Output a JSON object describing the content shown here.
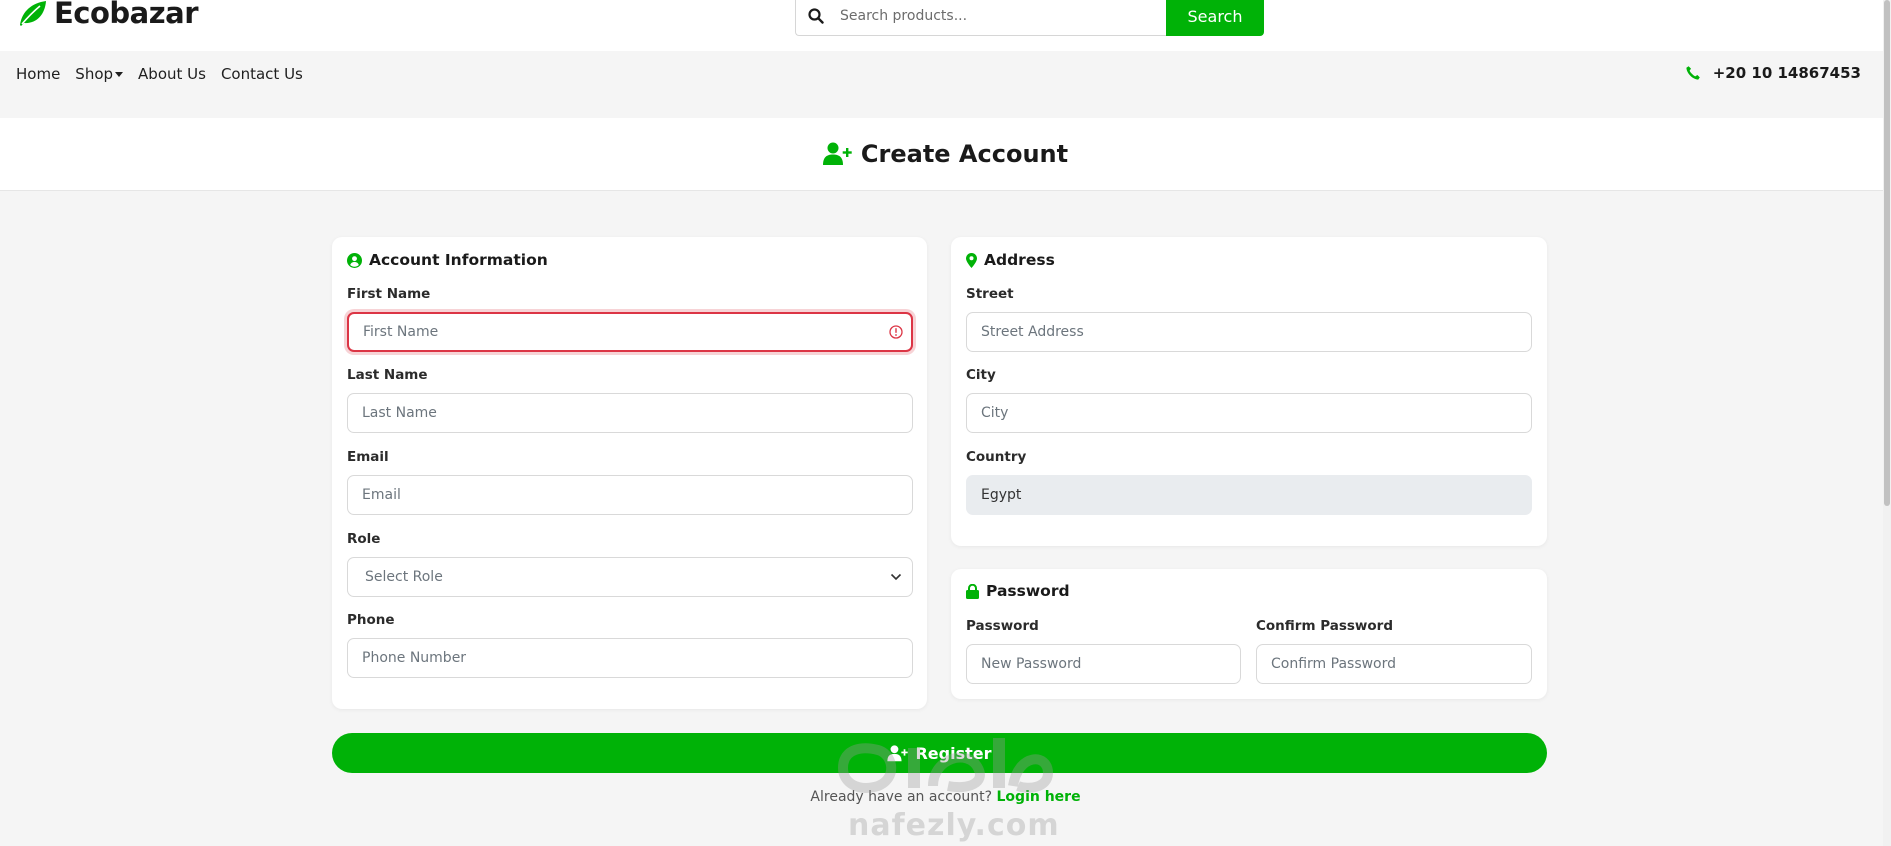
{
  "brand": {
    "name": "Ecobazar"
  },
  "search": {
    "placeholder": "Search products...",
    "button_label": "Search"
  },
  "nav": {
    "home": "Home",
    "shop": "Shop",
    "about": "About Us",
    "contact": "Contact Us"
  },
  "phone": "+20 10 14867453",
  "page": {
    "title": "Create Account"
  },
  "account": {
    "title": "Account Information",
    "first_name": {
      "label": "First Name",
      "placeholder": "First Name"
    },
    "last_name": {
      "label": "Last Name",
      "placeholder": "Last Name"
    },
    "email": {
      "label": "Email",
      "placeholder": "Email"
    },
    "role": {
      "label": "Role",
      "selected": "Select Role"
    },
    "phone": {
      "label": "Phone",
      "placeholder": "Phone Number"
    }
  },
  "address": {
    "title": "Address",
    "street": {
      "label": "Street",
      "placeholder": "Street Address"
    },
    "city": {
      "label": "City",
      "placeholder": "City"
    },
    "country": {
      "label": "Country",
      "value": "Egypt"
    }
  },
  "password": {
    "title": "Password",
    "password": {
      "label": "Password",
      "placeholder": "New Password"
    },
    "confirm": {
      "label": "Confirm Password",
      "placeholder": "Confirm Password"
    }
  },
  "register": {
    "label": "Register"
  },
  "login": {
    "prompt": "Already have an account?",
    "link": "Login here"
  },
  "watermark": {
    "text": "nafezly.com"
  },
  "colors": {
    "accent": "#00b207",
    "error": "#dc3545",
    "text": "#1a1a1a",
    "background": "#f5f5f5"
  },
  "icons": [
    "leaf-icon",
    "search-icon",
    "phone-icon",
    "user-plus-icon",
    "user-circle-icon",
    "map-marker-icon",
    "lock-icon",
    "error-icon",
    "chevron-down-icon"
  ]
}
